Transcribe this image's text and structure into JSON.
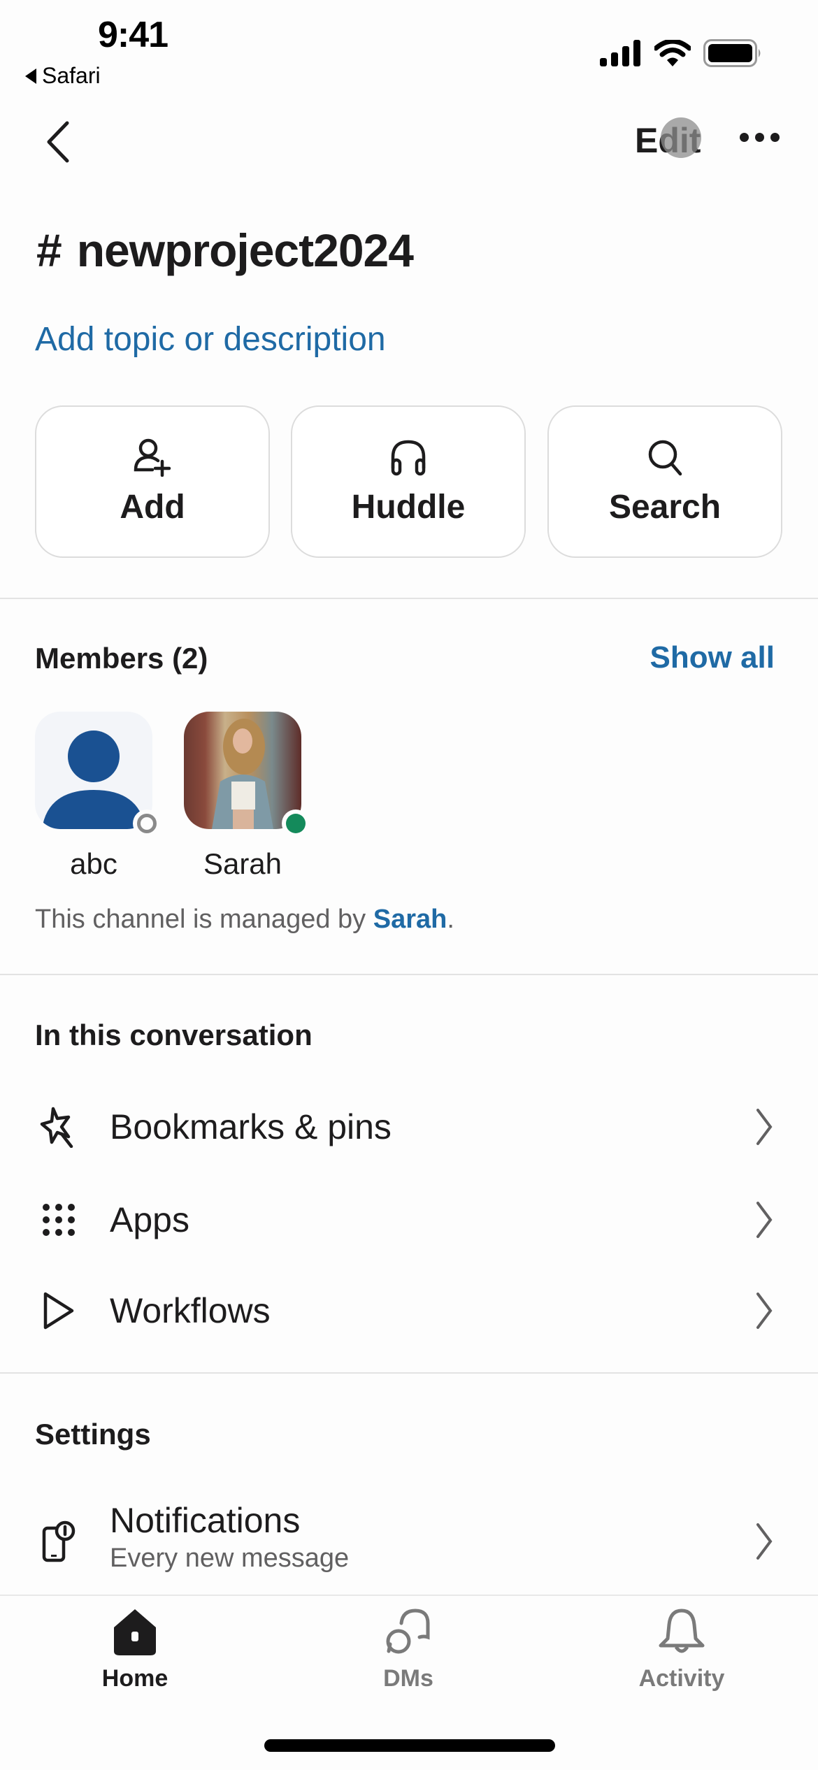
{
  "status_bar": {
    "time": "9:41",
    "back_app": "Safari",
    "icons": [
      "signal-icon",
      "wifi-icon",
      "battery-icon"
    ]
  },
  "nav": {
    "back_icon": "chevron-left-icon",
    "edit_label": "Edit",
    "more_icon": "ellipsis-icon"
  },
  "channel": {
    "prefix": "#",
    "name": "newproject2024",
    "topic_link": "Add topic or description"
  },
  "actions": [
    {
      "label": "Add",
      "icon": "add-person-icon"
    },
    {
      "label": "Huddle",
      "icon": "headphones-icon"
    },
    {
      "label": "Search",
      "icon": "search-icon"
    }
  ],
  "members": {
    "header": "Members (2)",
    "show_all": "Show all",
    "list": [
      {
        "name": "abc",
        "presence": "away",
        "avatar": "default-avatar"
      },
      {
        "name": "Sarah",
        "presence": "active",
        "avatar": "photo-avatar"
      }
    ],
    "managed_prefix": "This channel is managed by ",
    "managed_by": "Sarah",
    "managed_suffix": "."
  },
  "conversation": {
    "header": "In this conversation",
    "items": [
      {
        "label": "Bookmarks & pins",
        "icon": "pin-icon"
      },
      {
        "label": "Apps",
        "icon": "apps-grid-icon"
      },
      {
        "label": "Workflows",
        "icon": "play-icon"
      }
    ]
  },
  "settings": {
    "header": "Settings",
    "items": [
      {
        "label": "Notifications",
        "sublabel": "Every new message",
        "icon": "phone-notification-icon"
      }
    ]
  },
  "tabbar": {
    "items": [
      {
        "label": "Home",
        "active": true
      },
      {
        "label": "DMs",
        "active": false
      },
      {
        "label": "Activity",
        "active": false
      }
    ]
  },
  "colors": {
    "link": "#1f6aa5",
    "text": "#1d1c1d",
    "muted": "#616061",
    "active_presence": "#148a5b",
    "avatar_blue": "#1a5192"
  }
}
